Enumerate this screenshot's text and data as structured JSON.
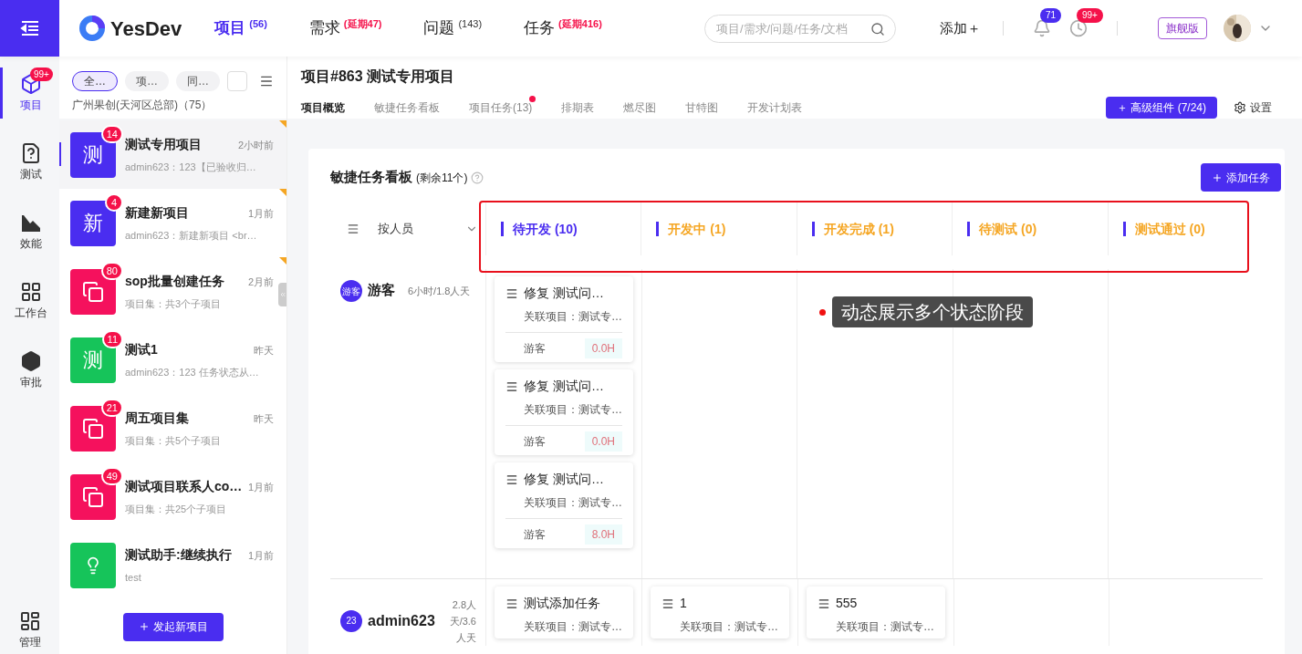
{
  "brand": "YesDev",
  "nav": [
    {
      "label": "项目",
      "count": "(56)",
      "alert": false,
      "selected": true
    },
    {
      "label": "需求",
      "count": "(延期47)",
      "alert": true,
      "selected": false
    },
    {
      "label": "问题",
      "count": "(143)",
      "alert": false,
      "selected": false
    },
    {
      "label": "任务",
      "count": "(延期416)",
      "alert": true,
      "selected": false
    }
  ],
  "search": {
    "placeholder": "项目/需求/问题/任务/文档"
  },
  "add_button": "添加＋",
  "notifications_badge": "71",
  "reminders_badge": "99+",
  "edition": "旗舰版",
  "rail": [
    {
      "kind": "project",
      "label": "项目",
      "badge": "99+",
      "selected": true
    },
    {
      "kind": "test",
      "label": "测试",
      "selected": false
    },
    {
      "kind": "perf",
      "label": "效能",
      "selected": false
    },
    {
      "kind": "workbench",
      "label": "工作台",
      "selected": false
    },
    {
      "kind": "approve",
      "label": "审批",
      "selected": false
    }
  ],
  "rail_bottom": {
    "kind": "manage",
    "label": "管理"
  },
  "project_list": {
    "filters": [
      {
        "label": "全…",
        "selected": true
      },
      {
        "label": "项…",
        "selected": false
      },
      {
        "label": "同…",
        "selected": false
      }
    ],
    "org": "广州果创(天河区总部)（75）",
    "items": [
      {
        "kind": "text",
        "avatar": "测",
        "color": "#4a2df0",
        "badge": "14",
        "title": "测试专用项目",
        "time": "2小时前",
        "subtitle": "admin623：123【已验收归…",
        "selected": true,
        "flagged": true
      },
      {
        "kind": "text",
        "avatar": "新",
        "color": "#4a2df0",
        "badge": "4",
        "title": "新建新项目",
        "time": "1月前",
        "subtitle": "admin623：新建新项目 <br…",
        "selected": false,
        "flagged": true
      },
      {
        "kind": "set",
        "color": "#f5115d",
        "badge": "80",
        "title": "sop批量创建任务",
        "time": "2月前",
        "subtitle": "项目集：共3个子项目",
        "selected": false,
        "flagged": true
      },
      {
        "kind": "text",
        "avatar": "测",
        "color": "#16c45a",
        "badge": "11",
        "title": "测试1",
        "time": "昨天",
        "subtitle": "admin623：123 任务状态从…",
        "selected": false,
        "flagged": false
      },
      {
        "kind": "set",
        "color": "#f5115d",
        "badge": "21",
        "title": "周五项目集",
        "time": "昨天",
        "subtitle": "项目集：共5个子项目",
        "selected": false,
        "flagged": false
      },
      {
        "kind": "set",
        "color": "#f5115d",
        "badge": "49",
        "title": "测试项目联系人co…",
        "time": "1月前",
        "subtitle": "项目集：共25个子项目",
        "selected": false,
        "flagged": false
      },
      {
        "kind": "bulb",
        "color": "#16c45a",
        "title": "测试助手:继续执行",
        "time": "1月前",
        "subtitle": "test",
        "selected": false,
        "flagged": false
      }
    ],
    "new_button": "发起新项目"
  },
  "header": {
    "title": "项目#863 测试专用项目",
    "tabs": [
      {
        "label": "项目概览",
        "selected": true,
        "dot": false
      },
      {
        "label": "敏捷任务看板",
        "selected": false,
        "dot": false
      },
      {
        "label": "项目任务(13)",
        "selected": false,
        "dot": true
      },
      {
        "label": "排期表",
        "selected": false,
        "dot": false
      },
      {
        "label": "燃尽图",
        "selected": false,
        "dot": false
      },
      {
        "label": "甘特图",
        "selected": false,
        "dot": false
      },
      {
        "label": "开发计划表",
        "selected": false,
        "dot": false
      }
    ],
    "advanced_button": "＋ 高级组件 (7/24)",
    "settings": "设置"
  },
  "board": {
    "title": "敏捷任务看板",
    "remaining": "(剩余11个)",
    "add_task": "添加任务",
    "group_by": "按人员",
    "columns": [
      {
        "label": "待开发 (10)",
        "color": "#4a2df0"
      },
      {
        "label": "开发中 (1)",
        "color": "#f5a623"
      },
      {
        "label": "开发完成 (1)",
        "color": "#f5a623"
      },
      {
        "label": "待测试 (0)",
        "color": "#f5a623"
      },
      {
        "label": "测试通过 (0)",
        "color": "#f5a623"
      }
    ],
    "callout": "动态展示多个状态阶段",
    "rows": [
      {
        "avatar": "游客",
        "name": "游客",
        "stat": "6小时/1.8人天",
        "cells": [
          [
            {
              "title": "修复 测试问…",
              "project": "关联项目：测试专…",
              "assignee": "游客",
              "hours": "0.0H"
            },
            {
              "title": "修复 测试问…",
              "project": "关联项目：测试专…",
              "assignee": "游客",
              "hours": "0.0H"
            },
            {
              "title": "修复 测试问…",
              "project": "关联项目：测试专…",
              "assignee": "游客",
              "hours": "8.0H"
            }
          ],
          [],
          [],
          [],
          []
        ]
      },
      {
        "avatar": "23",
        "name": "admin623",
        "stat": "2.8人天/3.6人天",
        "cells": [
          [
            {
              "title": "测试添加任务",
              "project": "关联项目：测试专…"
            }
          ],
          [
            {
              "title": "1",
              "project": "关联项目：测试专…"
            }
          ],
          [
            {
              "title": "555",
              "project": "关联项目：测试专…"
            }
          ],
          [],
          []
        ]
      }
    ]
  }
}
